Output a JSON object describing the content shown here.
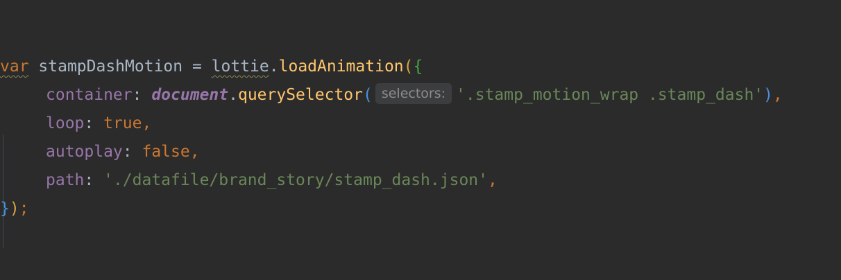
{
  "code": {
    "line1": {
      "keyword": "var",
      "variable": "stampDashMotion",
      "assign": " = ",
      "object": "lottie",
      "dot": ".",
      "method": "loadAnimation",
      "open_paren": "(",
      "open_brace": "{"
    },
    "line2": {
      "key": "container",
      "colon": ": ",
      "global": "document",
      "dot": ".",
      "method": "querySelector",
      "open_paren": "(",
      "param_hint": "selectors:",
      "string": "'.stamp_motion_wrap .stamp_dash'",
      "close_paren": ")",
      "comma": ","
    },
    "line3": {
      "key": "loop",
      "colon": ": ",
      "value": "true",
      "comma": ","
    },
    "line4": {
      "key": "autoplay",
      "colon": ": ",
      "value": "false",
      "comma": ","
    },
    "line5": {
      "key": "path",
      "colon": ": ",
      "value": "'./datafile/brand_story/stamp_dash.json'",
      "comma": ","
    },
    "line6": {
      "close_brace": "}",
      "close_paren": ")",
      "semicolon": ";"
    }
  }
}
